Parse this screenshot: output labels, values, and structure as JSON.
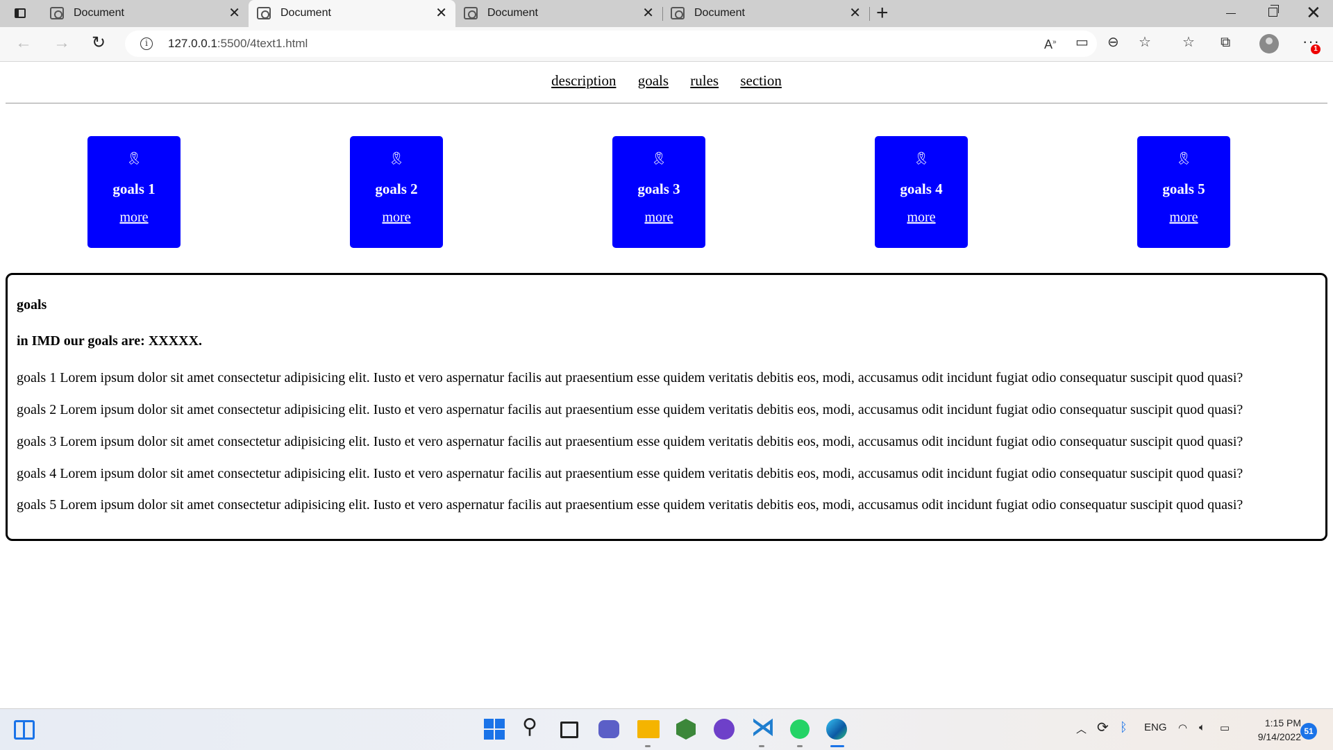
{
  "browser": {
    "tabs": [
      {
        "title": "Document",
        "active": false
      },
      {
        "title": "Document",
        "active": true
      },
      {
        "title": "Document",
        "active": false
      },
      {
        "title": "Document",
        "active": false
      }
    ],
    "address": {
      "host": "127.0.0.1",
      "rest": ":5500/4text1.html"
    },
    "menu_badge": "1"
  },
  "page": {
    "nav": [
      "description",
      "goals",
      "rules",
      "section"
    ],
    "cards": [
      {
        "icon": "🎗",
        "title": "goals 1",
        "link": "more"
      },
      {
        "icon": "🎗",
        "title": "goals 2",
        "link": "more"
      },
      {
        "icon": "🎗",
        "title": "goals 3",
        "link": "more"
      },
      {
        "icon": "🎗",
        "title": "goals 4",
        "link": "more"
      },
      {
        "icon": "🎗",
        "title": "goals 5",
        "link": "more"
      }
    ],
    "section": {
      "heading": "goals",
      "subheading": "in IMD our goals are: XXXXX.",
      "paragraphs": [
        "goals 1 Lorem ipsum dolor sit amet consectetur adipisicing elit. Iusto et vero aspernatur facilis aut praesentium esse quidem veritatis debitis eos, modi, accusamus odit incidunt fugiat odio consequatur suscipit quod quasi?",
        "goals 2 Lorem ipsum dolor sit amet consectetur adipisicing elit. Iusto et vero aspernatur facilis aut praesentium esse quidem veritatis debitis eos, modi, accusamus odit incidunt fugiat odio consequatur suscipit quod quasi?",
        "goals 3 Lorem ipsum dolor sit amet consectetur adipisicing elit. Iusto et vero aspernatur facilis aut praesentium esse quidem veritatis debitis eos, modi, accusamus odit incidunt fugiat odio consequatur suscipit quod quasi?",
        "goals 4 Lorem ipsum dolor sit amet consectetur adipisicing elit. Iusto et vero aspernatur facilis aut praesentium esse quidem veritatis debitis eos, modi, accusamus odit incidunt fugiat odio consequatur suscipit quod quasi?",
        "goals 5 Lorem ipsum dolor sit amet consectetur adipisicing elit. Iusto et vero aspernatur facilis aut praesentium esse quidem veritatis debitis eos, modi, accusamus odit incidunt fugiat odio consequatur suscipit quod quasi?"
      ]
    }
  },
  "taskbar": {
    "language": "ENG",
    "time": "1:15 PM",
    "date": "9/14/2022",
    "notifications": "51"
  },
  "colors": {
    "card_bg": "#0000ff",
    "accent": "#1a73e8"
  }
}
